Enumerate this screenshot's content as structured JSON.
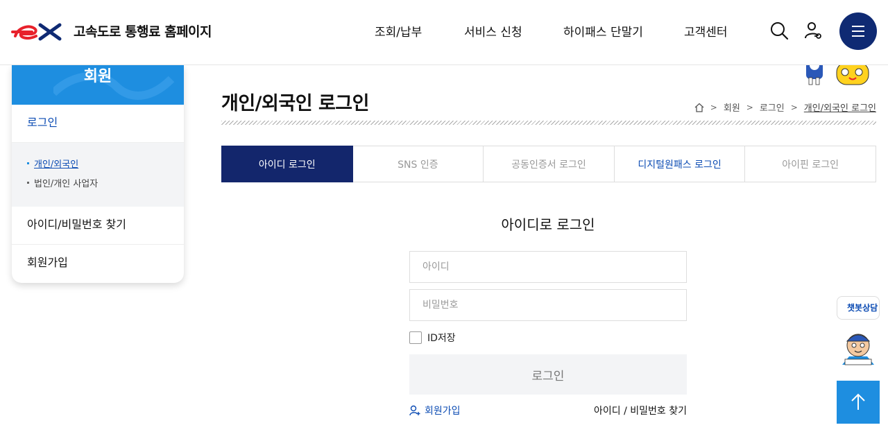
{
  "header": {
    "site_title": "고속도로 통행료 홈페이지",
    "nav": [
      "조회/납부",
      "서비스 신청",
      "하이패스 단말기",
      "고객센터"
    ],
    "icons": [
      "search-icon",
      "user-key-icon",
      "hamburger-menu-icon"
    ],
    "brand_color": "#e8212b",
    "menu_color": "#0f2a73"
  },
  "sidebar": {
    "title": "회원",
    "items": [
      {
        "label": "로그인",
        "active": true
      },
      {
        "label": "아이디/비밀번호 찾기"
      },
      {
        "label": "회원가입"
      }
    ],
    "sub_items": [
      {
        "label": "개인/외국인",
        "active": true
      },
      {
        "label": "법인/개인 사업자"
      }
    ],
    "accent": "#1e8ee0"
  },
  "main": {
    "page_title": "개인/외국인 로그인",
    "breadcrumb": [
      "회원",
      "로그인",
      "개인/외국인 로그인"
    ],
    "tabs": [
      {
        "label": "아이디 로그인",
        "active": true
      },
      {
        "label": "SNS 인증"
      },
      {
        "label": "공동인증서 로그인"
      },
      {
        "label": "디지털원패스 로그인",
        "highlight": true
      },
      {
        "label": "아이핀 로그인"
      }
    ],
    "form": {
      "title": "아이디로 로그인",
      "id_placeholder": "아이디",
      "pw_placeholder": "비밀번호",
      "save_id_label": "ID저장",
      "login_button": "로그인",
      "join_link": "회원가입",
      "find_link": "아이디 / 비밀번호 찾기"
    },
    "active_tab_color": "#13266c"
  },
  "floating": {
    "chatbot_label": "챗봇상담",
    "top_icon": "arrow-up-icon"
  }
}
